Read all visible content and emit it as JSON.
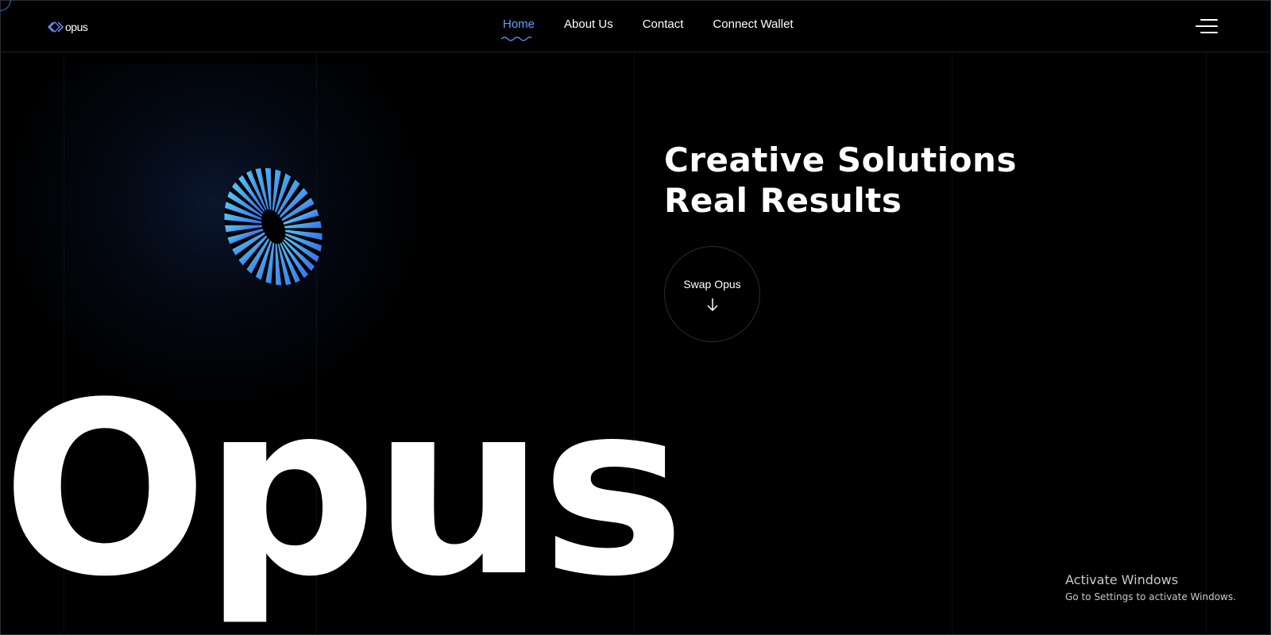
{
  "brand": {
    "name": "opus",
    "accent_color": "#6d9dff",
    "torus_gradient": [
      "#55c8f5",
      "#3a7be8"
    ]
  },
  "nav": {
    "items": [
      {
        "label": "Home",
        "active": true
      },
      {
        "label": "About Us",
        "active": false
      },
      {
        "label": "Contact",
        "active": false
      },
      {
        "label": "Connect Wallet",
        "active": false
      }
    ],
    "menu_icon": "hamburger-menu-icon"
  },
  "hero": {
    "headline_line1": "Creative Solutions",
    "headline_line2": "Real Results",
    "cta_label": "Swap Opus",
    "cta_icon": "arrow-down-icon",
    "big_word": "Opus",
    "visual": "striped-torus-graphic"
  },
  "system_overlay": {
    "title": "Activate Windows",
    "subtitle": "Go to Settings to activate Windows."
  }
}
